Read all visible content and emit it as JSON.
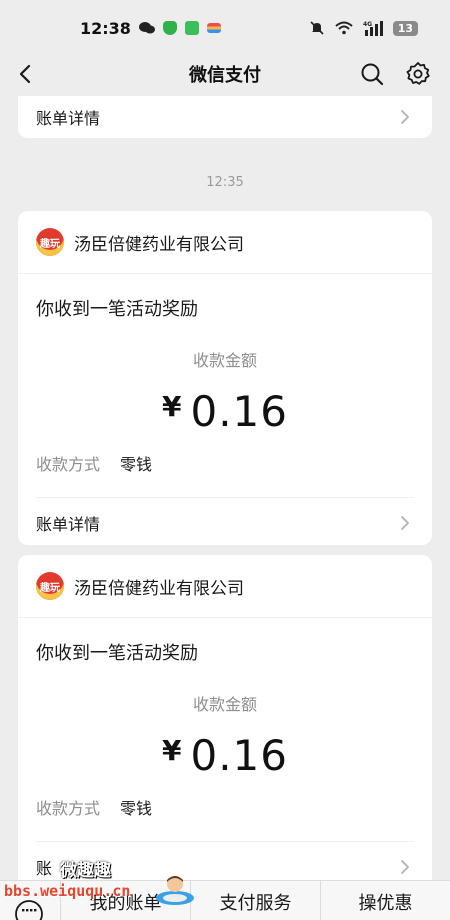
{
  "status": {
    "time": "12:38",
    "battery": "13",
    "network": "4G"
  },
  "nav": {
    "title": "微信支付"
  },
  "top_card": {
    "detail_label": "账单详情"
  },
  "timestamp": "12:35",
  "cards": [
    {
      "company": "汤臣倍健药业有限公司",
      "logo_text": "趣玩",
      "title": "你收到一笔活动奖励",
      "amount_label": "收款金额",
      "currency": "¥",
      "amount": "0.16",
      "method_label": "收款方式",
      "method_value": "零钱",
      "detail_label": "账单详情"
    },
    {
      "company": "汤臣倍健药业有限公司",
      "logo_text": "趣玩",
      "title": "你收到一笔活动奖励",
      "amount_label": "收款金额",
      "currency": "¥",
      "amount": "0.16",
      "method_label": "收款方式",
      "method_value": "零钱",
      "detail_label": "账"
    }
  ],
  "tabbar": {
    "tabs": [
      "我的账单",
      "支付服务",
      "操优惠"
    ]
  },
  "watermark": {
    "title": "微趣趣",
    "url": "bbs.weiququ.cn"
  },
  "colors": {
    "background": "#ededed",
    "card": "#ffffff",
    "logo": "#e23b2e",
    "watermark_url": "#e8452c"
  }
}
